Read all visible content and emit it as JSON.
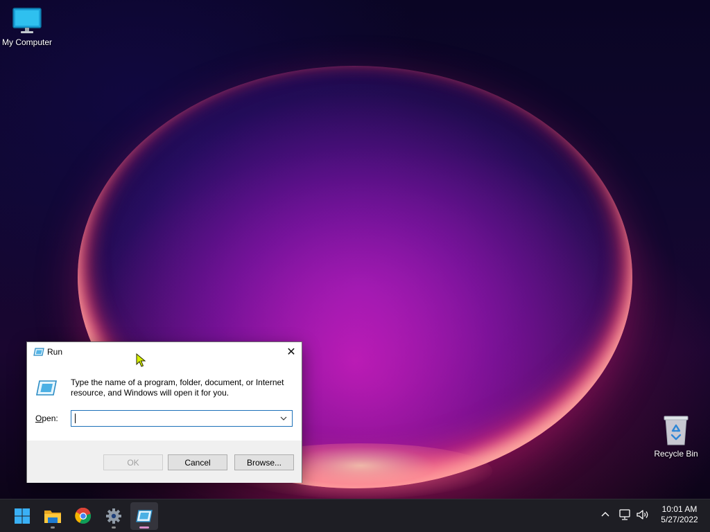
{
  "desktop": {
    "icons": [
      {
        "label": "My Computer",
        "icon": "monitor-icon"
      },
      {
        "label": "Recycle Bin",
        "icon": "recycle-bin-icon"
      }
    ]
  },
  "run_dialog": {
    "title": "Run",
    "close_glyph": "✕",
    "description": "Type the name of a program, folder, document, or Internet resource, and Windows will open it for you.",
    "open_label_accel": "O",
    "open_label_rest": "pen:",
    "open_value": "",
    "buttons": {
      "ok": "OK",
      "cancel": "Cancel",
      "browse": "Browse..."
    }
  },
  "taskbar": {
    "apps": [
      {
        "name": "Start",
        "icon": "windows-logo-icon"
      },
      {
        "name": "File Explorer",
        "icon": "folder-icon"
      },
      {
        "name": "Google Chrome",
        "icon": "chrome-icon"
      },
      {
        "name": "Settings",
        "icon": "gear-icon"
      },
      {
        "name": "Run",
        "icon": "run-icon",
        "active": true
      }
    ],
    "tray": {
      "icons": [
        "chevron-up-icon",
        "network-icon",
        "volume-icon"
      ],
      "time": "10:01 AM",
      "date": "5/27/2022"
    }
  },
  "colors": {
    "taskbar_bg": "#1e1e24",
    "input_focus_border": "#1b6fb8",
    "dialog_footer_bg": "#f0f0f0",
    "active_indicator": "#d98cc7"
  }
}
